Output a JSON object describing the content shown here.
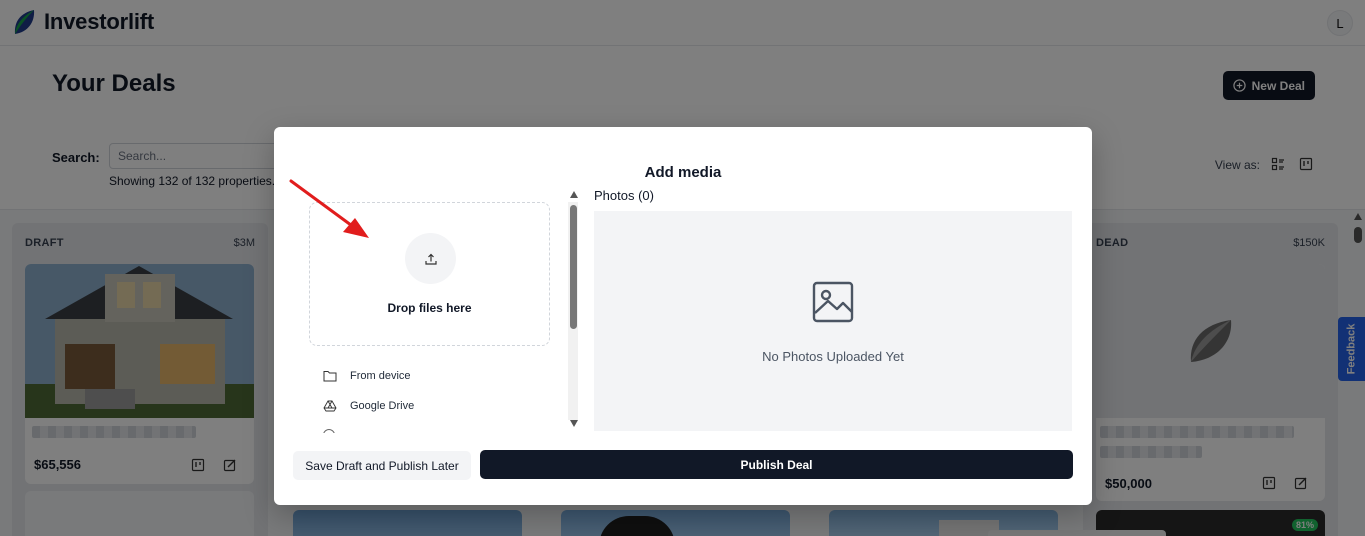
{
  "app": {
    "name": "Investorlift",
    "user_initial": "L"
  },
  "page": {
    "title": "Your Deals",
    "new_deal_label": "New Deal",
    "search_label": "Search:",
    "search_placeholder": "Search...",
    "showing_text": "Showing 132 of 132 properties.",
    "view_as_label": "View as:"
  },
  "columns": [
    {
      "status": "DRAFT",
      "total": "$3M",
      "card_price": "$65,556"
    },
    {
      "status": "DEAD",
      "total": "$150K",
      "card_price": "$50,000"
    }
  ],
  "badge_pct": "81%",
  "feedback_label": "Feedback",
  "modal": {
    "title": "Add media",
    "drop_text": "Drop files here",
    "sources": [
      {
        "label": "From device",
        "icon": "folder-icon"
      },
      {
        "label": "Google Drive",
        "icon": "google-drive-icon"
      }
    ],
    "photos_label": "Photos (0)",
    "empty_text": "No Photos Uploaded Yet",
    "save_draft_label": "Save Draft and Publish Later",
    "publish_label": "Publish Deal"
  },
  "colors": {
    "primary": "#111827",
    "feedback": "#2563eb",
    "annotation": "#e11d1d",
    "logo_green": "#16a34a",
    "logo_blue": "#1e3a8a"
  }
}
